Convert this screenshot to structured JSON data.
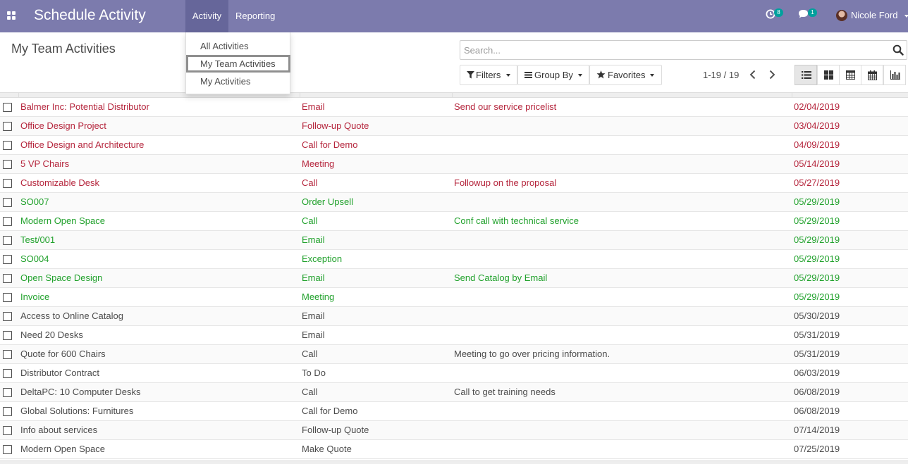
{
  "navbar": {
    "app_title": "Schedule Activity",
    "menus": [
      "Activity",
      "Reporting"
    ],
    "activity_badge": "8",
    "messages_badge": "1",
    "user_name": "Nicole Ford"
  },
  "activity_menu": {
    "items": [
      "All Activities",
      "My Team Activities",
      "My Activities"
    ],
    "selected": "My Team Activities"
  },
  "control_panel": {
    "title": "My Team Activities",
    "search_placeholder": "Search...",
    "filters_label": "Filters",
    "group_by_label": "Group By",
    "favorites_label": "Favorites",
    "pager": "1-19 / 19",
    "views": [
      "list",
      "kanban",
      "pivot",
      "calendar",
      "graph"
    ],
    "active_view": "list"
  },
  "colors": {
    "navbar": "#7c7bad",
    "overdue": "#b5253c",
    "today": "#21a12c",
    "badge": "#00a09d"
  },
  "rows": [
    {
      "name": "Balmer Inc: Potential Distributor",
      "type": "Email",
      "summary": "Send our service pricelist",
      "date": "02/04/2019",
      "state": "overdue"
    },
    {
      "name": "Office Design Project",
      "type": "Follow-up Quote",
      "summary": "",
      "date": "03/04/2019",
      "state": "overdue"
    },
    {
      "name": "Office Design and Architecture",
      "type": "Call for Demo",
      "summary": "",
      "date": "04/09/2019",
      "state": "overdue"
    },
    {
      "name": "5 VP Chairs",
      "type": "Meeting",
      "summary": "",
      "date": "05/14/2019",
      "state": "overdue"
    },
    {
      "name": "Customizable Desk",
      "type": "Call",
      "summary": "Followup on the proposal",
      "date": "05/27/2019",
      "state": "overdue"
    },
    {
      "name": "SO007",
      "type": "Order Upsell",
      "summary": "",
      "date": "05/29/2019",
      "state": "today"
    },
    {
      "name": "Modern Open Space",
      "type": "Call",
      "summary": "Conf call with technical service",
      "date": "05/29/2019",
      "state": "today"
    },
    {
      "name": "Test/001",
      "type": "Email",
      "summary": "",
      "date": "05/29/2019",
      "state": "today"
    },
    {
      "name": "SO004",
      "type": "Exception",
      "summary": "",
      "date": "05/29/2019",
      "state": "today"
    },
    {
      "name": "Open Space Design",
      "type": "Email",
      "summary": "Send Catalog by Email",
      "date": "05/29/2019",
      "state": "today"
    },
    {
      "name": "Invoice",
      "type": "Meeting",
      "summary": "",
      "date": "05/29/2019",
      "state": "today"
    },
    {
      "name": "Access to Online Catalog",
      "type": "Email",
      "summary": "",
      "date": "05/30/2019",
      "state": "planned"
    },
    {
      "name": "Need 20 Desks",
      "type": "Email",
      "summary": "",
      "date": "05/31/2019",
      "state": "planned"
    },
    {
      "name": "Quote for 600 Chairs",
      "type": "Call",
      "summary": "Meeting to go over pricing information.",
      "date": "05/31/2019",
      "state": "planned"
    },
    {
      "name": "Distributor Contract",
      "type": "To Do",
      "summary": "",
      "date": "06/03/2019",
      "state": "planned"
    },
    {
      "name": "DeltaPC: 10 Computer Desks",
      "type": "Call",
      "summary": "Call to get training needs",
      "date": "06/08/2019",
      "state": "planned"
    },
    {
      "name": "Global Solutions: Furnitures",
      "type": "Call for Demo",
      "summary": "",
      "date": "06/08/2019",
      "state": "planned"
    },
    {
      "name": "Info about services",
      "type": "Follow-up Quote",
      "summary": "",
      "date": "07/14/2019",
      "state": "planned"
    },
    {
      "name": "Modern Open Space",
      "type": "Make Quote",
      "summary": "",
      "date": "07/25/2019",
      "state": "planned"
    }
  ]
}
